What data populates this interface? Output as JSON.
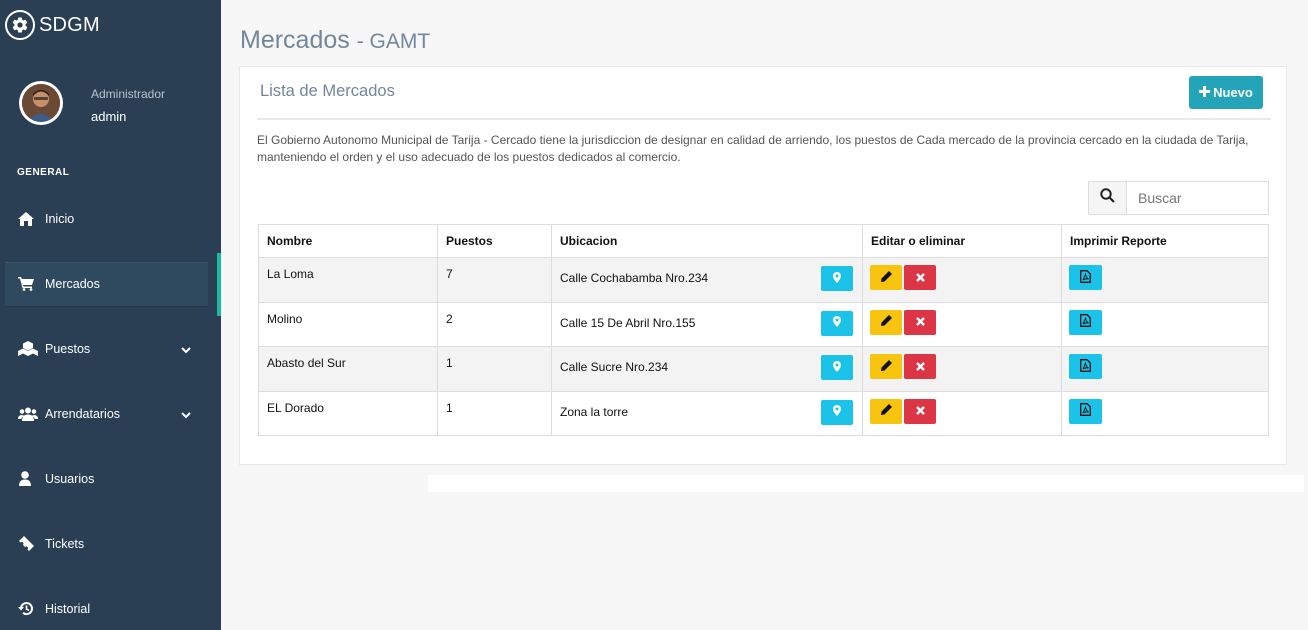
{
  "brand": {
    "title": "SDGM",
    "icon": "gear-icon"
  },
  "profile": {
    "role": "Administrador",
    "username": "admin"
  },
  "sidebar": {
    "section_title": "GENERAL",
    "items": [
      {
        "label": "Inicio",
        "icon": "home-icon"
      },
      {
        "label": "Mercados",
        "icon": "cart-icon",
        "active": true
      },
      {
        "label": "Puestos",
        "icon": "cubes-icon",
        "has_submenu": true
      },
      {
        "label": "Arrendatarios",
        "icon": "users-icon",
        "has_submenu": true
      },
      {
        "label": "Usuarios",
        "icon": "user-icon"
      },
      {
        "label": "Tickets",
        "icon": "ticket-icon"
      },
      {
        "label": "Historial",
        "icon": "history-icon"
      }
    ]
  },
  "page": {
    "title": "Mercados",
    "subtitle": "- GAMT"
  },
  "panel": {
    "title": "Lista de Mercados",
    "new_button": "Nuevo",
    "description": "El Gobierno Autonomo Municipal de Tarija - Cercado tiene la jurisdiccion de designar en calidad de arriendo, los puestos de Cada mercado de la provincia cercado en la ciudada de Tarija, manteniendo el orden y el uso adecuado de los puestos dedicados al comercio."
  },
  "search": {
    "placeholder": "Buscar",
    "value": ""
  },
  "table": {
    "headers": [
      "Nombre",
      "Puestos",
      "Ubicacion",
      "Editar o eliminar",
      "Imprimir Reporte"
    ],
    "rows": [
      {
        "nombre": "La Loma",
        "puestos": "7",
        "ubicacion": "Calle Cochabamba Nro.234"
      },
      {
        "nombre": "Molino",
        "puestos": "2",
        "ubicacion": "Calle 15 De Abril Nro.155"
      },
      {
        "nombre": "Abasto del Sur",
        "puestos": "1",
        "ubicacion": "Calle Sucre Nro.234"
      },
      {
        "nombre": "EL Dorado",
        "puestos": "1",
        "ubicacion": "Zona la torre"
      }
    ]
  },
  "colors": {
    "sidebar_bg": "#2a3f54",
    "active_accent": "#1abb9c",
    "new_button": "#23a4b8",
    "location_button": "#1cc3e8",
    "edit_button": "#f7c40f",
    "delete_button": "#dc3545"
  }
}
